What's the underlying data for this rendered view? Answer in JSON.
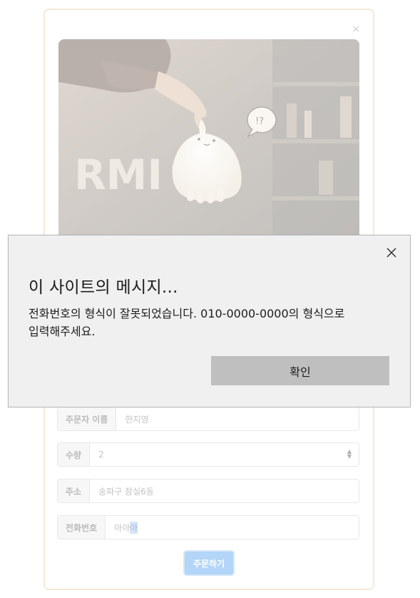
{
  "modal": {
    "close_glyph": "×"
  },
  "form": {
    "name_label": "주문자 이름",
    "name_value": "한지영",
    "qty_label": "수량",
    "qty_value": "2",
    "address_label": "주소",
    "address_value": "송파구 잠실6동",
    "phone_label": "전화번호",
    "phone_value_plain": "아아",
    "phone_value_selected": "아",
    "submit_label": "주문하기"
  },
  "alert": {
    "title": "이 사이트의 메시지...",
    "message_line1": "전화번호의 형식이 잘못되었습니다. 010-0000-0000의 형식으로",
    "message_line2": "입력해주세요.",
    "ok_label": "확인",
    "close_icon": "close-icon"
  },
  "photo": {
    "sign_text": "RMI",
    "bubble_text": "!?"
  },
  "colors": {
    "card_border": "#efdfc8",
    "submit_bg": "#8ec2f5",
    "alert_bg": "#f0f0f0",
    "ok_bg": "#bfbfbf"
  }
}
